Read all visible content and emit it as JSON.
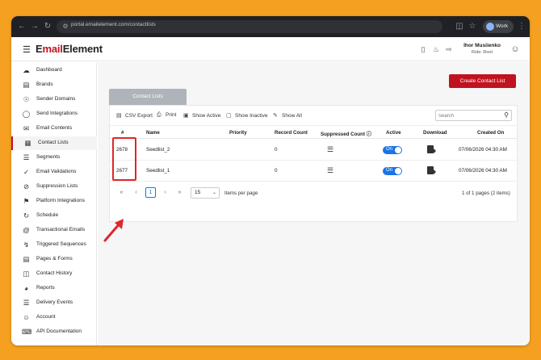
{
  "browser": {
    "url": "portal.emailelement.com/contactlists",
    "profile": "Work",
    "back_icon": "back-arrow-icon",
    "forward_icon": "forward-arrow-icon",
    "reload_icon": "reload-icon"
  },
  "header": {
    "logo_prefix": "E",
    "logo_mid": "mail",
    "logo_suffix": "Element",
    "user_name": "Ihor Musiienko",
    "user_role": "Role: Root",
    "brand_color": "#c1121f"
  },
  "sidebar": {
    "items": [
      {
        "label": "Dashboard",
        "icon": "cloud-icon"
      },
      {
        "label": "Brands",
        "icon": "brands-icon"
      },
      {
        "label": "Sender Domains",
        "icon": "globe-icon"
      },
      {
        "label": "Send Integrations",
        "icon": "integration-icon"
      },
      {
        "label": "Email Contents",
        "icon": "envelope-icon"
      },
      {
        "label": "Contact Lists",
        "icon": "book-icon",
        "active": true
      },
      {
        "label": "Segments",
        "icon": "segments-icon"
      },
      {
        "label": "Email Validations",
        "icon": "check-circle-icon"
      },
      {
        "label": "Suppression Lists",
        "icon": "block-icon"
      },
      {
        "label": "Platform Integrations",
        "icon": "tag-icon"
      },
      {
        "label": "Schedule",
        "icon": "schedule-icon"
      },
      {
        "label": "Transactional Emails",
        "icon": "at-icon"
      },
      {
        "label": "Triggered Sequences",
        "icon": "bolt-icon"
      },
      {
        "label": "Pages & Forms",
        "icon": "pages-icon"
      },
      {
        "label": "Contact History",
        "icon": "history-icon"
      },
      {
        "label": "Reports",
        "icon": "reports-icon"
      },
      {
        "label": "Delivery Events",
        "icon": "events-icon"
      },
      {
        "label": "Account",
        "icon": "account-icon"
      },
      {
        "label": "API Documentation",
        "icon": "api-icon"
      }
    ]
  },
  "main": {
    "create_button": "Create Contact List",
    "tab": "Contact Lists",
    "toolbar": {
      "csv_export": "CSV Export",
      "print": "Print",
      "show_active": "Show Active",
      "show_inactive": "Show Inactive",
      "show_all": "Show All"
    },
    "search_placeholder": "Search",
    "columns": [
      "#",
      "Name",
      "Priority",
      "Record Count",
      "Suppressed Count",
      "Active",
      "Download",
      "Created On"
    ],
    "rows": [
      {
        "id": "2678",
        "name": "Seedlist_2",
        "priority": "",
        "record_count": "0",
        "active": "On",
        "created_on": "07/06/2026 04:30 AM"
      },
      {
        "id": "2677",
        "name": "Seedlist_1",
        "priority": "",
        "record_count": "0",
        "active": "On",
        "created_on": "07/06/2026 04:30 AM"
      }
    ],
    "pager": {
      "current_page": "1",
      "page_size": "15",
      "items_per_page": "Items per page",
      "summary": "1 of 1 pages (2 items)"
    }
  },
  "annotation": {
    "highlight_color": "#e0262a"
  }
}
